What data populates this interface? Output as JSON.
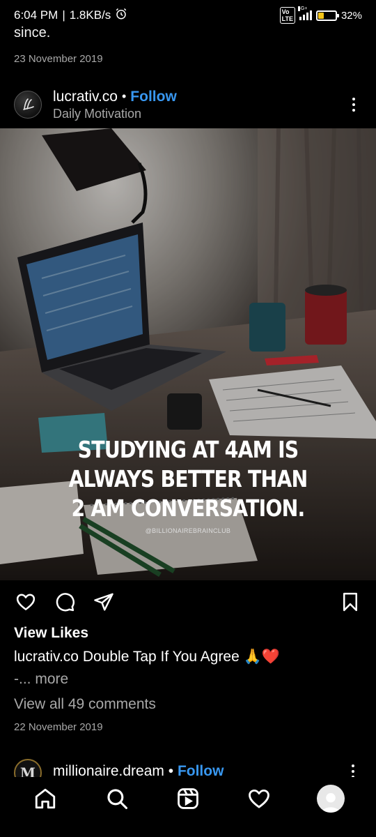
{
  "status_bar": {
    "time": "6:04 PM",
    "separator": "|",
    "speed": "1.8KB/s",
    "volte": "Vo LTE",
    "network": "4G+",
    "battery": "32%",
    "battery_level": 0.32,
    "alarm_icon": "alarm-icon",
    "battery_color": "#f5c518"
  },
  "previous_post": {
    "caption_tail": "since.",
    "date": "23 November 2019"
  },
  "post": {
    "username": "lucrativ.co",
    "dot": "•",
    "follow_label": "Follow",
    "subtitle": "Daily Motivation",
    "image_quote_lines": [
      "STUDYING AT 4AM IS",
      "ALWAYS BETTER THAN",
      "2 AM CONVERSATION."
    ],
    "watermark": "@BILLIONAIREBRAINCLUB",
    "view_likes_label": "View Likes",
    "caption_user": "lucrativ.co",
    "caption_text": " Double Tap If You Agree 🙏❤️",
    "caption_more_prefix": "-...",
    "caption_more": " more",
    "view_comments": "View all 49 comments",
    "date": "22 November 2019"
  },
  "next_post": {
    "avatar_letter": "M",
    "username": "millionaire.dream",
    "dot": "•",
    "follow_label": "Follow"
  },
  "nav": {
    "items": [
      "home-icon",
      "search-icon",
      "reels-icon",
      "activity-heart-icon",
      "profile-avatar"
    ]
  },
  "colors": {
    "accent": "#3897f0",
    "secondary_text": "#a8a8a8",
    "background": "#000000",
    "like_heart": "#e0242c"
  }
}
